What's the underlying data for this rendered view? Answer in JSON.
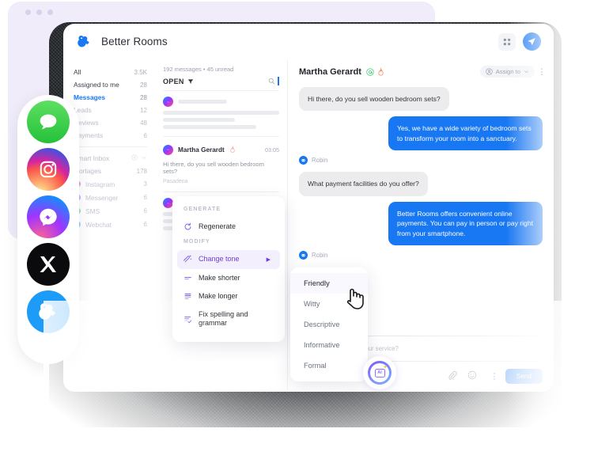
{
  "back_card": {
    "dots": 3
  },
  "header": {
    "brand_name": "Better Rooms",
    "logo_icon": "better-rooms-bird-logo",
    "grid_icon": "apps-grid-icon",
    "send_icon": "paper-plane-icon"
  },
  "sidebar": {
    "items": [
      {
        "label": "All",
        "count": "3.5K",
        "state": "normal"
      },
      {
        "label": "Assigned to me",
        "count": "28",
        "state": "normal"
      },
      {
        "label": "Messages",
        "count": "28",
        "state": "active"
      },
      {
        "label": "Leads",
        "count": "12",
        "state": "dim"
      },
      {
        "label": "Reviews",
        "count": "48",
        "state": "dim"
      },
      {
        "label": "Payments",
        "count": "6",
        "state": "dim"
      }
    ],
    "section": {
      "label": "Smart Inbox",
      "add_icon": "plus-circle-icon",
      "chevron_icon": "chevron-down-icon"
    },
    "group": {
      "label": "Mortages",
      "count": "178"
    },
    "channels": [
      {
        "label": "Instagram",
        "count": "3",
        "color": "#e1306c"
      },
      {
        "label": "Messenger",
        "count": "6",
        "color": "#a033ff"
      },
      {
        "label": "SMS",
        "count": "6",
        "color": "#25c13a"
      },
      {
        "label": "Webchat",
        "count": "6",
        "color": "#1d9bf8"
      }
    ]
  },
  "conversation_list": {
    "meta": "192 messages • 45 unread",
    "filter_label": "OPEN",
    "filter_icon": "filter-funnel-icon",
    "search_icon": "search-icon",
    "items": [
      {
        "name": "",
        "time": "",
        "snippet": "",
        "location": "",
        "placeholder": true
      },
      {
        "name": "Martha Gerardt",
        "time": "03:05",
        "snippet": "Hi there, do you sell wooden bedroom sets?",
        "location": "Pasadena",
        "placeholder": false
      },
      {
        "name": "",
        "time": "",
        "snippet": "",
        "location": "",
        "placeholder": true
      }
    ]
  },
  "chat": {
    "contact_name": "Martha Gerardt",
    "badge_at_icon": "at-mention-icon",
    "badge_fire_icon": "hot-lead-flame-icon",
    "assign_label": "Assign to",
    "assign_user_icon": "user-circle-icon",
    "assign_chevron_icon": "chevron-down-icon",
    "more_icon": "kebab-menu-icon",
    "messages": [
      {
        "direction": "in",
        "text": "Hi there, do you sell wooden bedroom sets?"
      },
      {
        "direction": "out",
        "text": "Yes, we have a wide variety of bedroom sets to transform your room into a sanctuary.",
        "sender": "Robin"
      },
      {
        "direction": "in",
        "text": "What payment facilities do you offer?"
      },
      {
        "direction": "out",
        "text": "Better Rooms offers convenient online payments. You can pay in person or pay right from your smartphone.",
        "sender": "Robin"
      }
    ]
  },
  "composer": {
    "placeholder": "Thanks for choosing our service?",
    "attach_icon": "paperclip-icon",
    "emoji_icon": "emoji-smiley-icon",
    "more_icon": "kebab-menu-icon",
    "send_label": "Send",
    "ai_button": {
      "label": "AI",
      "icon": "ai-sparkle-icon"
    }
  },
  "ai_menu": {
    "generate_label": "GENERATE",
    "generate_items": [
      {
        "label": "Regenerate",
        "icon": "refresh-circle-icon"
      }
    ],
    "modify_label": "MODIFY",
    "modify_items": [
      {
        "label": "Change tone",
        "icon": "tone-wand-icon",
        "selected": true,
        "has_submenu": true
      },
      {
        "label": "Make shorter",
        "icon": "make-shorter-icon",
        "selected": false,
        "has_submenu": false
      },
      {
        "label": "Make longer",
        "icon": "make-longer-icon",
        "selected": false,
        "has_submenu": false
      },
      {
        "label": "Fix spelling and grammar",
        "icon": "spellcheck-icon",
        "selected": false,
        "has_submenu": false
      }
    ]
  },
  "tone_menu": {
    "options": [
      {
        "label": "Friendly",
        "selected": true
      },
      {
        "label": "Witty",
        "selected": false
      },
      {
        "label": "Descriptive",
        "selected": false
      },
      {
        "label": "Informative",
        "selected": false
      },
      {
        "label": "Formal",
        "selected": false
      }
    ]
  },
  "channel_rail": {
    "icons": [
      {
        "name": "sms-icon",
        "label": "SMS"
      },
      {
        "name": "instagram-icon",
        "label": "Instagram"
      },
      {
        "name": "messenger-icon",
        "label": "Messenger"
      },
      {
        "name": "x-twitter-icon",
        "label": "X"
      },
      {
        "name": "webchat-bird-icon",
        "label": "Webchat"
      }
    ]
  },
  "colors": {
    "brand_blue": "#1877f2",
    "accent_purple": "#6c3ee0",
    "bubble_in": "#ececee",
    "back_card": "#f0ecf9"
  }
}
